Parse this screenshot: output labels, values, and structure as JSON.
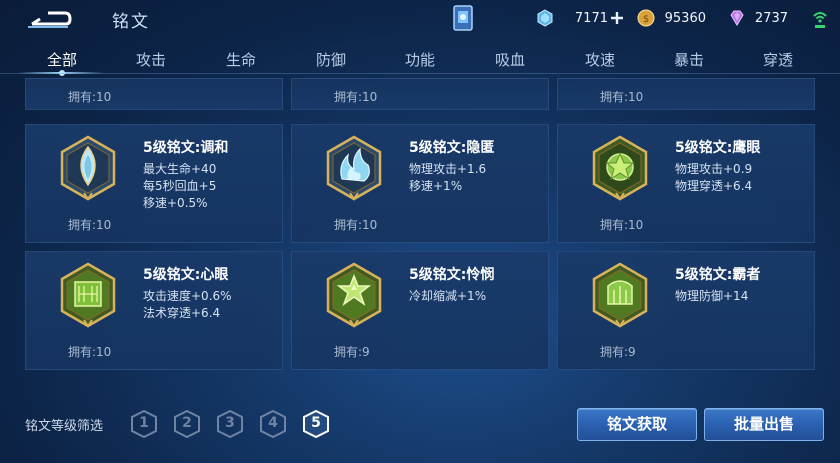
{
  "header": {
    "title": "铭文",
    "currencies": [
      {
        "icon": "gem-crystal-icon",
        "value": "7171",
        "add": true
      },
      {
        "icon": "gold-coin-icon",
        "value": "95360"
      },
      {
        "icon": "diamond-icon",
        "value": "2737"
      }
    ]
  },
  "tabs": [
    "全部",
    "攻击",
    "生命",
    "防御",
    "功能",
    "吸血",
    "攻速",
    "暴击",
    "穿透"
  ],
  "active_tab": "全部",
  "partial_row": [
    "拥有:10",
    "拥有:10",
    "拥有:10"
  ],
  "cards": [
    {
      "name": "5级铭文:调和",
      "stats": [
        "最大生命+40",
        "每5秒回血+5",
        "移速+0.5%"
      ],
      "owned": "拥有:10",
      "icon": "harmony-rune-icon"
    },
    {
      "name": "5级铭文:隐匿",
      "stats": [
        "物理攻击+1.6",
        "移速+1%"
      ],
      "owned": "拥有:10",
      "icon": "stealth-rune-icon"
    },
    {
      "name": "5级铭文:鹰眼",
      "stats": [
        "物理攻击+0.9",
        "物理穿透+6.4"
      ],
      "owned": "拥有:10",
      "icon": "eagle-eye-rune-icon"
    },
    {
      "name": "5级铭文:心眼",
      "stats": [
        "攻击速度+0.6%",
        "法术穿透+6.4"
      ],
      "owned": "拥有:10",
      "icon": "mind-eye-rune-icon"
    },
    {
      "name": "5级铭文:怜悯",
      "stats": [
        "冷却缩减+1%"
      ],
      "owned": "拥有:9",
      "icon": "mercy-rune-icon"
    },
    {
      "name": "5级铭文:霸者",
      "stats": [
        "物理防御+14"
      ],
      "owned": "拥有:9",
      "icon": "overlord-rune-icon"
    }
  ],
  "filter": {
    "label": "铭文等级筛选",
    "levels": [
      "1",
      "2",
      "3",
      "4",
      "5"
    ],
    "selected": "5"
  },
  "buttons": {
    "acquire": "铭文获取",
    "bulk_sell": "批量出售"
  },
  "colors": {
    "accent": "#9fd8ff",
    "button": "#2f66b6",
    "rune_gold": "#d8b25a",
    "rune_green": "#7fbf3a"
  }
}
